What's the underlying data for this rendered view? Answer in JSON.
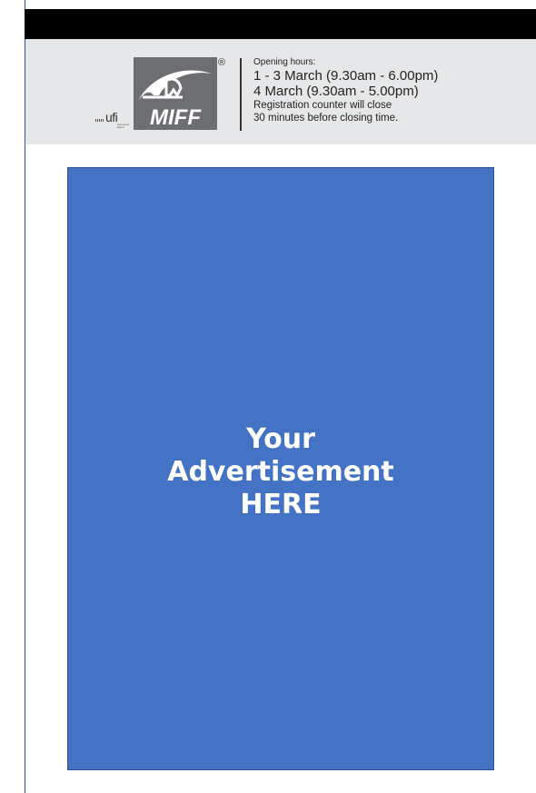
{
  "header": {
    "logo_text": "MIFF",
    "registered_mark": "®",
    "ufi_text": "ufi",
    "ufi_subtext": "Approved Event",
    "opening_label": "Opening hours:",
    "hours_line1": "1 - 3 March (9.30am - 6.00pm)",
    "hours_line2": "4 March (9.30am - 5.00pm)",
    "notice_line1": "Registration counter will close",
    "notice_line2": "30 minutes before closing time."
  },
  "advertisement": {
    "line1": "Your",
    "line2": "Advertisement",
    "line3": "HERE"
  },
  "colors": {
    "top_bar": "#000000",
    "info_strip": "#e6e7e8",
    "ad_fill": "#4472c4",
    "ad_border": "#2f528f",
    "logo_fill": "#6d6e71",
    "text_dark": "#222222"
  }
}
